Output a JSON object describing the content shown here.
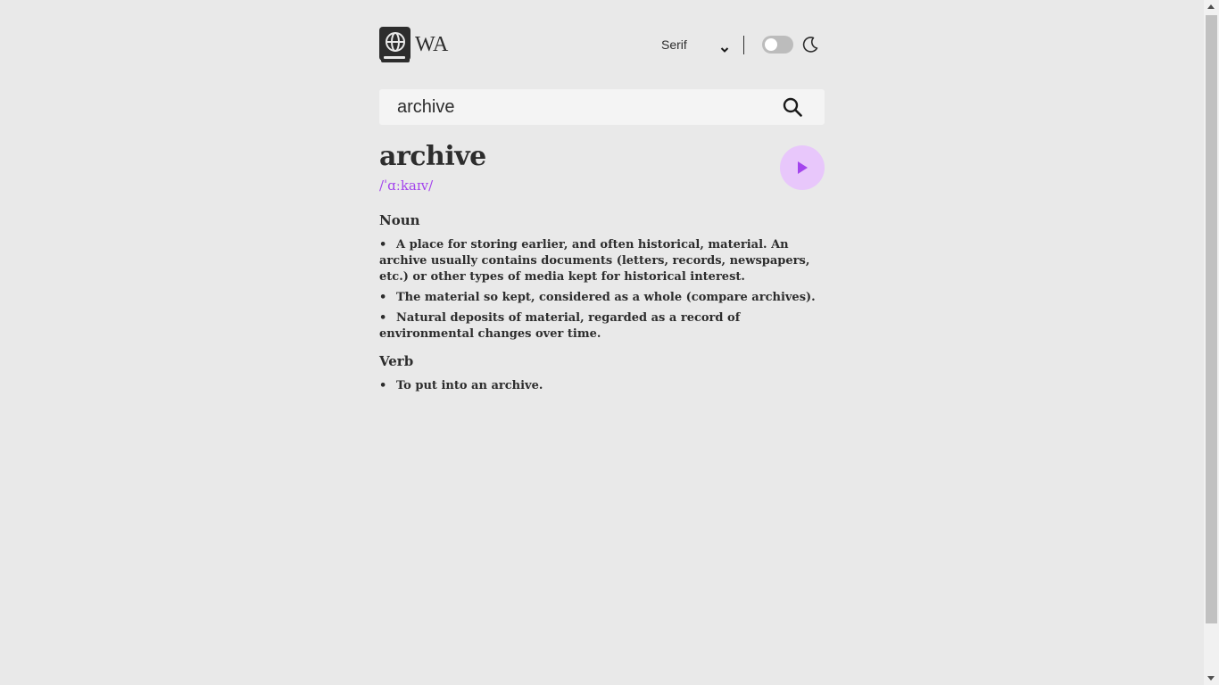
{
  "header": {
    "brand": "WA",
    "font_select": {
      "value": "Serif",
      "options": [
        "Serif"
      ]
    },
    "theme_toggle": {
      "state": "off",
      "icon": "moon-icon"
    },
    "logo_icon": "book-globe-icon"
  },
  "search": {
    "value": "archive",
    "icon": "search-icon"
  },
  "entry": {
    "word": "archive",
    "phonetic": "/ˈɑːkaɪv/",
    "play_icon": "play-icon",
    "accent_color": "#a445ed",
    "meanings": [
      {
        "part_of_speech": "Noun",
        "definitions": [
          "A place for storing earlier, and often historical, material. An archive usually contains documents (letters, records, newspapers, etc.) or other types of media kept for historical interest.",
          "The material so kept, considered as a whole (compare archives).",
          "Natural deposits of material, regarded as a record of environmental changes over time."
        ]
      },
      {
        "part_of_speech": "Verb",
        "definitions": [
          "To put into an archive."
        ]
      }
    ]
  },
  "bullet": "•"
}
